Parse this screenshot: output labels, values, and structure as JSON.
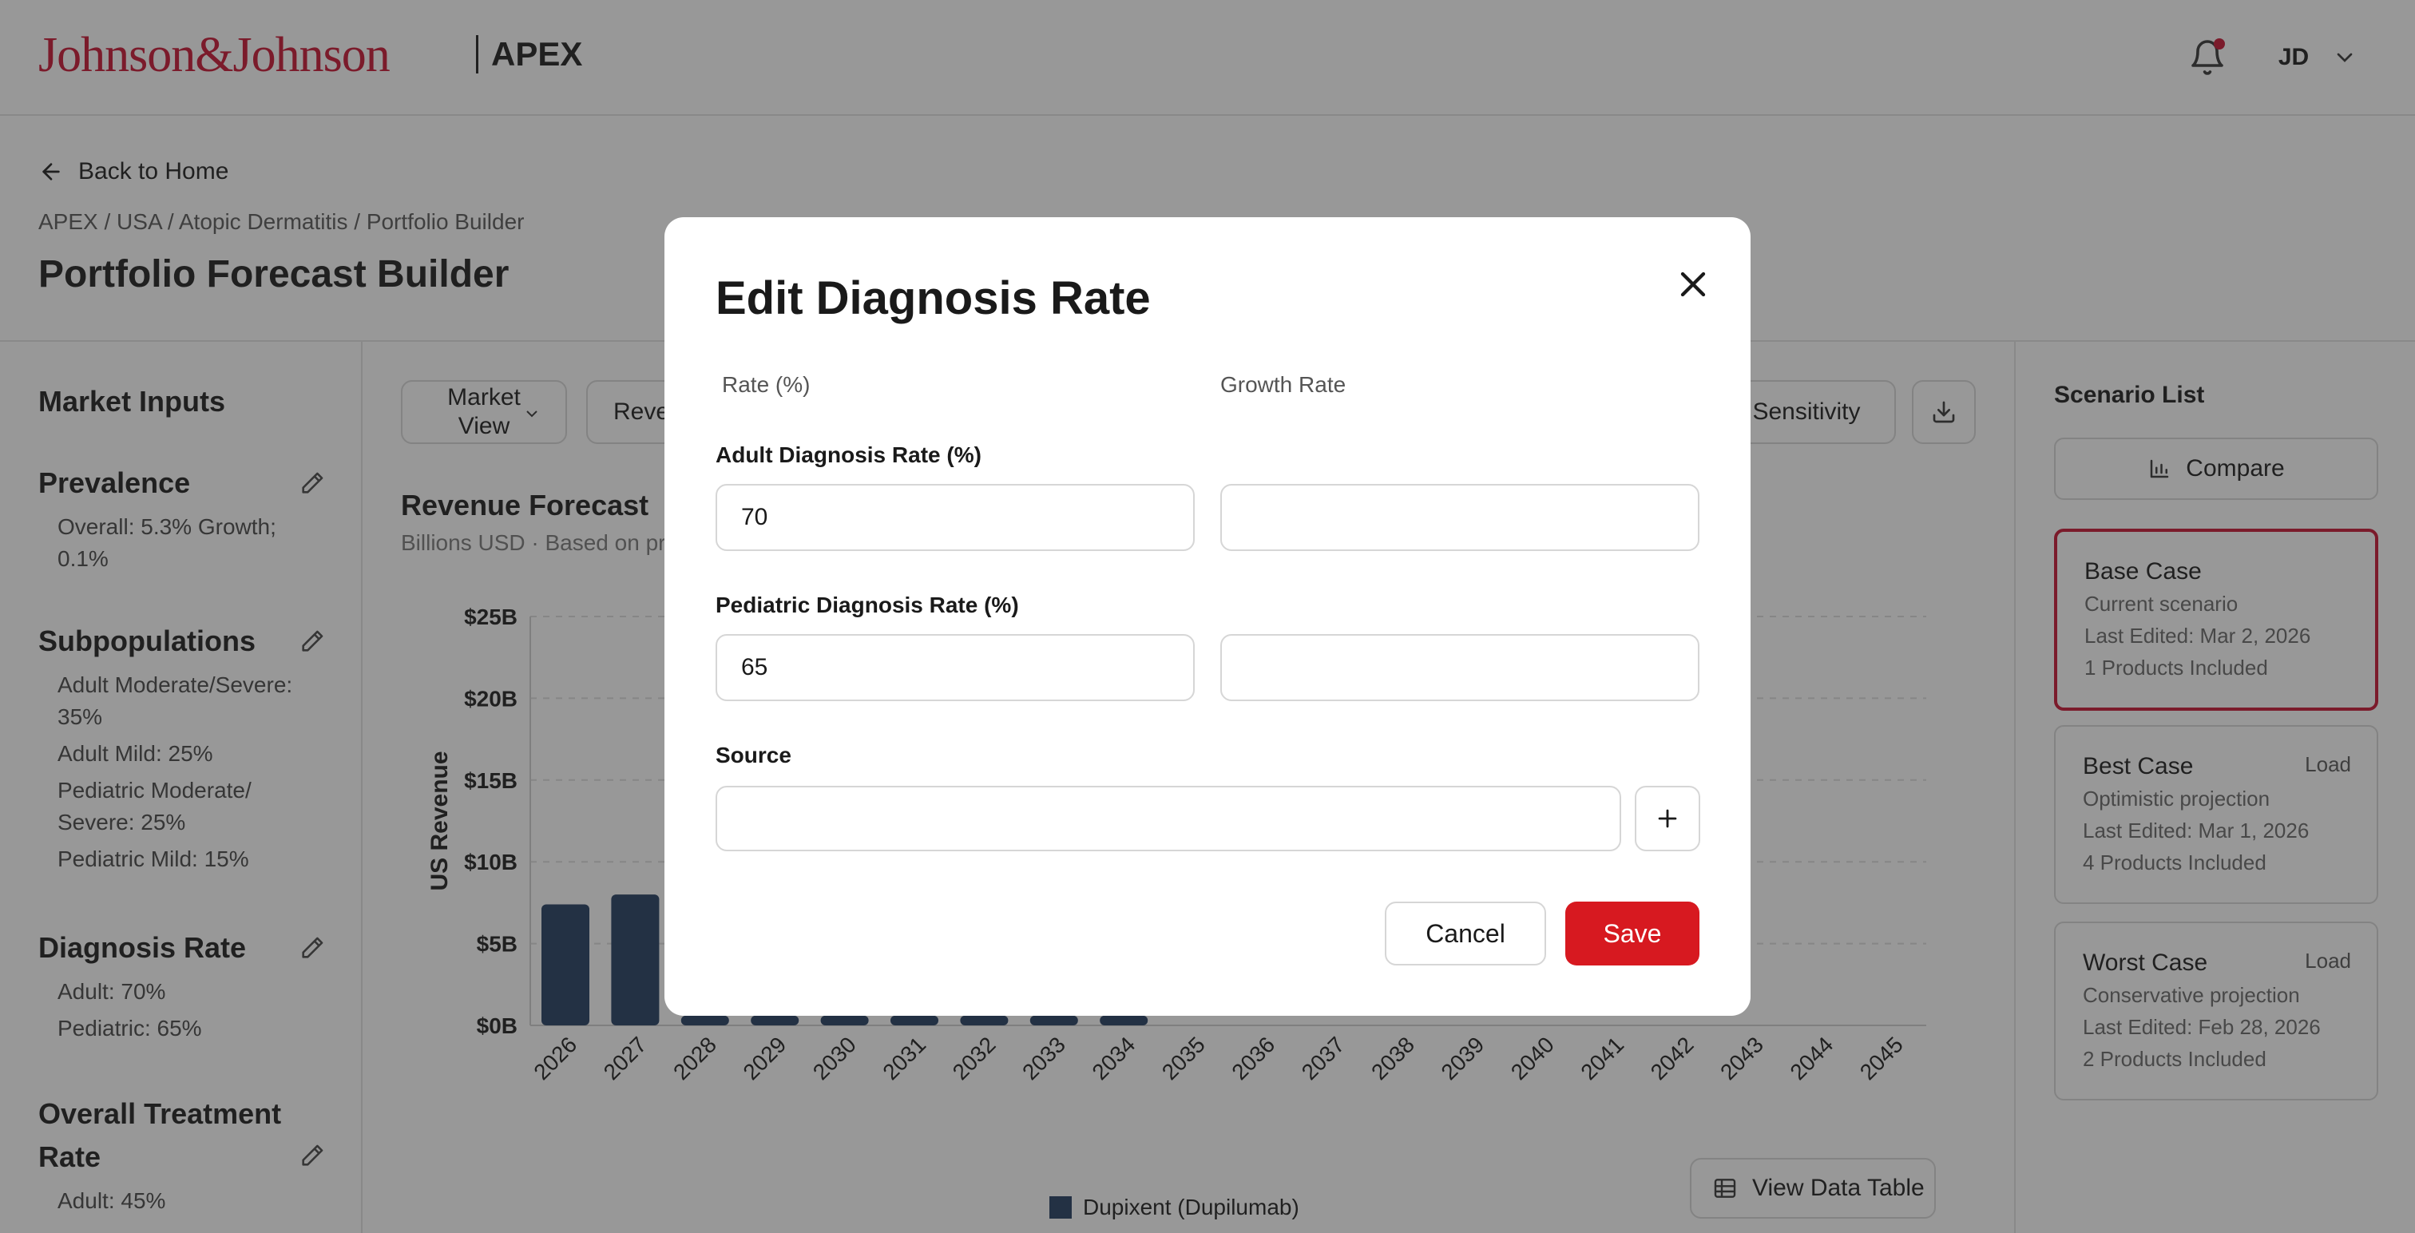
{
  "header": {
    "brand": "Johnson&Johnson",
    "product": "APEX",
    "user_initials": "JD",
    "icons": {
      "bell": "bell-icon",
      "chevron": "chevron-down-icon"
    },
    "colors": {
      "brand": "#c8102e",
      "notification": "#c8102e"
    }
  },
  "page": {
    "back_label": "Back to Home",
    "breadcrumb": "APEX / USA / Atopic Dermatitis / Portfolio Builder",
    "title": "Portfolio Forecast Builder"
  },
  "sidebar": {
    "title": "Market Inputs",
    "sections": [
      {
        "name": "Prevalence",
        "lines": [
          "Overall: 5.3% Growth; 0.1%"
        ]
      },
      {
        "name": "Subpopulations",
        "lines": [
          "Adult Moderate/Severe: 35%",
          "Adult Mild: 25%",
          "Pediatric Moderate/ Severe: 25%",
          "Pediatric Mild: 15%"
        ]
      },
      {
        "name": "Diagnosis Rate",
        "lines": [
          "Adult: 70%",
          "Pediatric: 65%"
        ]
      },
      {
        "name": "Overall Treatment Rate",
        "lines": [
          "Adult: 45%"
        ]
      }
    ]
  },
  "toolbar": {
    "market_view": "Market View",
    "revenue": "Reve",
    "sensitivity": "Sensitivity",
    "icons": {
      "download": "download-icon"
    }
  },
  "chart_data": {
    "type": "bar",
    "title": "Revenue Forecast",
    "subtitle": "Billions USD · Based on pr",
    "ylabel": "US Revenue",
    "xlabel": "",
    "ylim": [
      0,
      25
    ],
    "yticks": [
      "$0B",
      "$5B",
      "$10B",
      "$15B",
      "$20B",
      "$25B"
    ],
    "categories": [
      "2026",
      "2027",
      "2028",
      "2029",
      "2030",
      "2031",
      "2032",
      "2033",
      "2034",
      "2035",
      "2036",
      "2037",
      "2038",
      "2039",
      "2040",
      "2041",
      "2042",
      "2043",
      "2044",
      "2045"
    ],
    "series": [
      {
        "name": "Dupixent (Dupilumab)",
        "color": "#1f3a5f",
        "values": [
          7.4,
          8.0,
          0.6,
          0.6,
          0.6,
          0.6,
          0.6,
          0.6,
          0.6,
          null,
          null,
          null,
          null,
          null,
          null,
          null,
          null,
          null,
          null,
          null
        ]
      }
    ],
    "grid": true,
    "legend": "bottom-center"
  },
  "view_table_label": "View Data Table",
  "scenarios": {
    "title": "Scenario List",
    "compare_label": "Compare",
    "items": [
      {
        "name": "Base Case",
        "desc": "Current scenario",
        "edited": "Last Edited: Mar 2, 2026",
        "products": "1 Products Included",
        "action": "",
        "active": true
      },
      {
        "name": "Best Case",
        "desc": "Optimistic projection",
        "edited": "Last Edited: Mar 1, 2026",
        "products": "4 Products Included",
        "action": "Load",
        "active": false
      },
      {
        "name": "Worst Case",
        "desc": "Conservative projection",
        "edited": "Last Edited: Feb 28, 2026",
        "products": "2 Products Included",
        "action": "Load",
        "active": false
      }
    ]
  },
  "modal": {
    "title": "Edit Diagnosis Rate",
    "col_rate": "Rate (%)",
    "col_growth": "Growth Rate",
    "adult_label": "Adult Diagnosis Rate (%)",
    "adult_value": "70",
    "adult_growth": "",
    "pediatric_label": "Pediatric Diagnosis Rate (%)",
    "pediatric_value": "65",
    "pediatric_growth": "",
    "source_label": "Source",
    "source_value": "",
    "cancel_label": "Cancel",
    "save_label": "Save",
    "colors": {
      "save": "#d71920"
    }
  }
}
